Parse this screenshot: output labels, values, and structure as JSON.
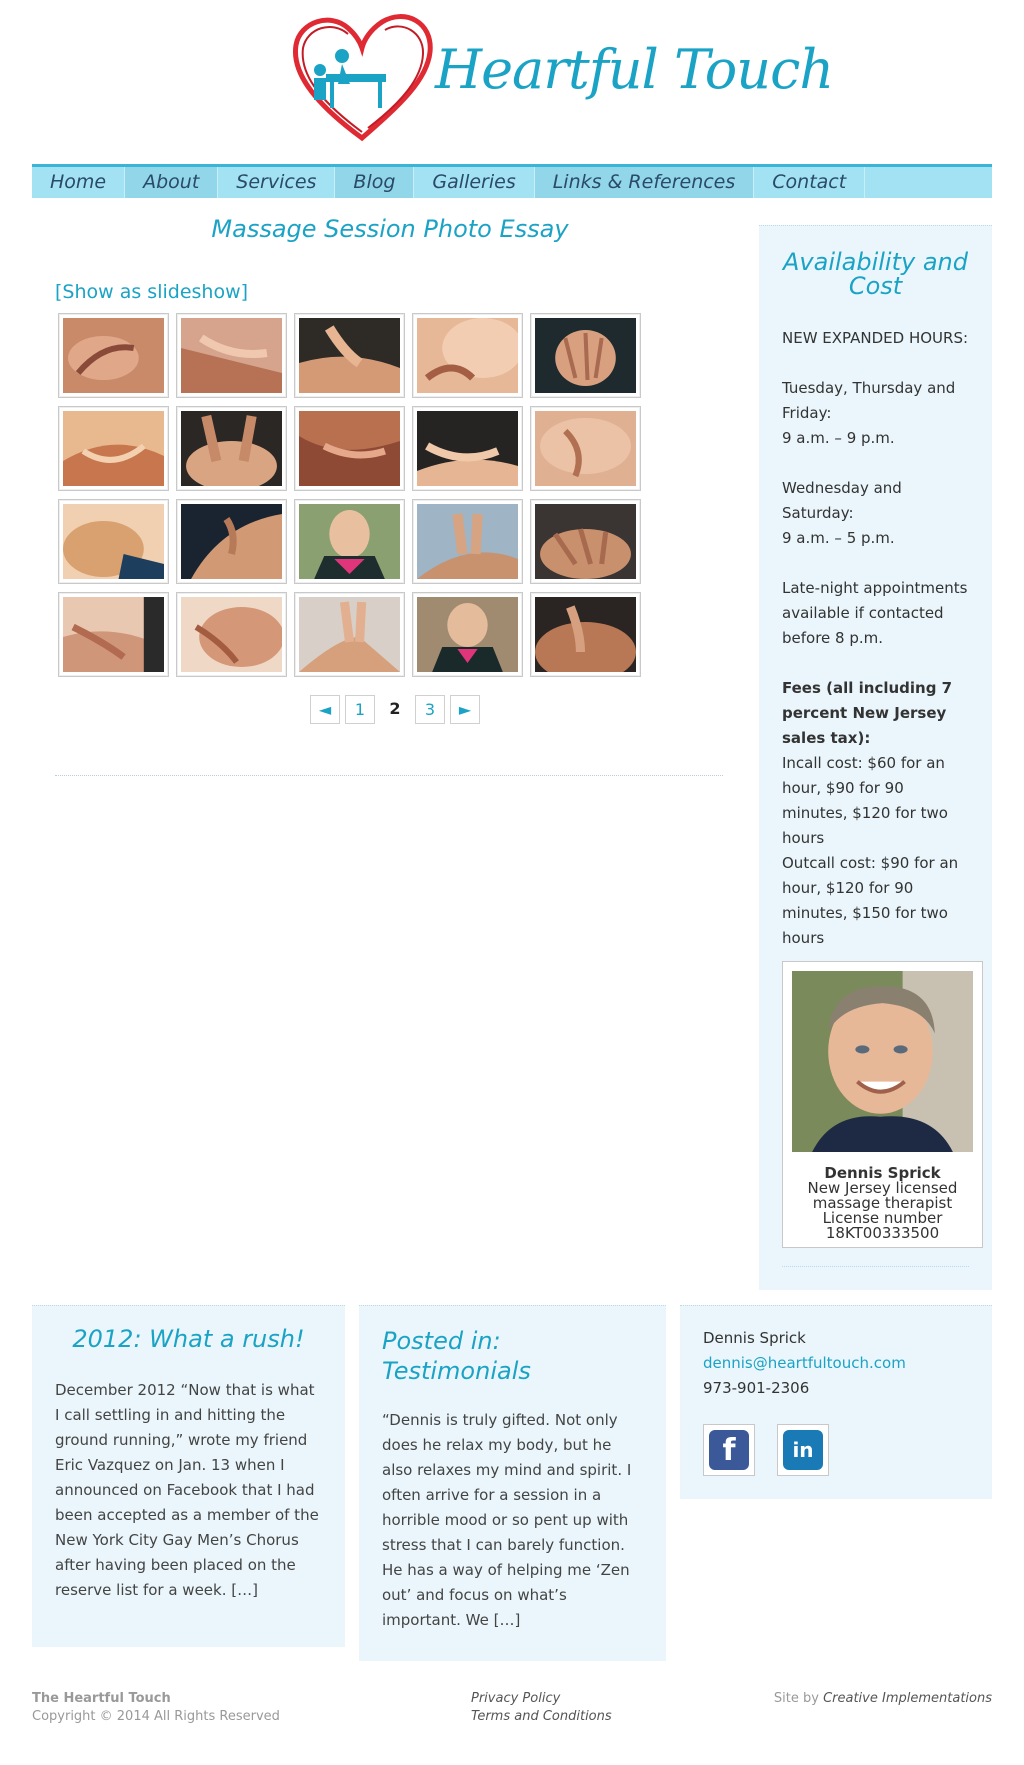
{
  "header": {
    "logo_text": "Heartful Touch"
  },
  "nav": {
    "items": [
      "Home",
      "About",
      "Services",
      "Blog",
      "Galleries",
      "Links & References",
      "Contact"
    ]
  },
  "main": {
    "title": "Massage Session Photo Essay",
    "slideshow_link": "[Show as slideshow]",
    "pager": {
      "prev": "◄",
      "pages": [
        "1",
        "2",
        "3"
      ],
      "current": "2",
      "next": "►"
    }
  },
  "sidebar": {
    "title": "Availability and Cost",
    "hours_heading": "NEW EXPANDED HOURS:",
    "days1": "Tuesday, Thursday and Friday:",
    "hours1": "9 a.m. – 9 p.m.",
    "days2": "Wednesday and Saturday:",
    "hours2": "9 a.m. – 5 p.m.",
    "late_night": "Late-night appointments available if  contacted before 8 p.m.",
    "fees_heading": "Fees (all including 7 percent New Jersey sales tax):",
    "incall": "Incall cost: $60 for an hour, $90 for 90 minutes, $120 for two hours",
    "outcall": "Outcall cost: $90 for an hour, $120 for 90 minutes, $150 for two hours",
    "profile": {
      "name": "Dennis Sprick",
      "line1": "New Jersey licensed",
      "line2": "massage therapist",
      "line3": "License number",
      "line4": "18KT00333500"
    }
  },
  "widgets": {
    "blog": {
      "title": "2012: What a rush!",
      "text": "December 2012 “Now that is what I call settling in and hitting the ground running,” wrote my friend Eric Vazquez on Jan. 13 when I announced on Facebook that I had been accepted as a member of the New York City Gay Men’s Chorus after having been placed on the reserve list for a week. […]"
    },
    "testimonial": {
      "title": "Posted in: Testimonials",
      "text": "“Dennis is truly gifted. Not only does he relax my body, but he also relaxes my mind and spirit. I often arrive for a session in a horrible mood or so pent up with stress that I can barely function. He has a way of helping me ‘Zen out’ and focus on what’s important. We […]"
    },
    "contact": {
      "name": "Dennis Sprick",
      "email": "dennis@heartfultouch.com",
      "phone": "973-901-2306",
      "facebook_glyph": "f",
      "linkedin_glyph": "in"
    }
  },
  "footer": {
    "brand": "The Heartful Touch",
    "copyright": "Copyright © 2014 All Rights Reserved",
    "privacy": "Privacy Policy",
    "terms": "Terms and Conditions",
    "site_by_prefix": "Site by ",
    "site_by_link": "Creative Implementations"
  },
  "colors": {
    "accent": "#1ba3c6",
    "nav_bg": "#a2e2f3",
    "panel_bg": "#eaf6fb",
    "logo_heart": "#e02a33"
  }
}
